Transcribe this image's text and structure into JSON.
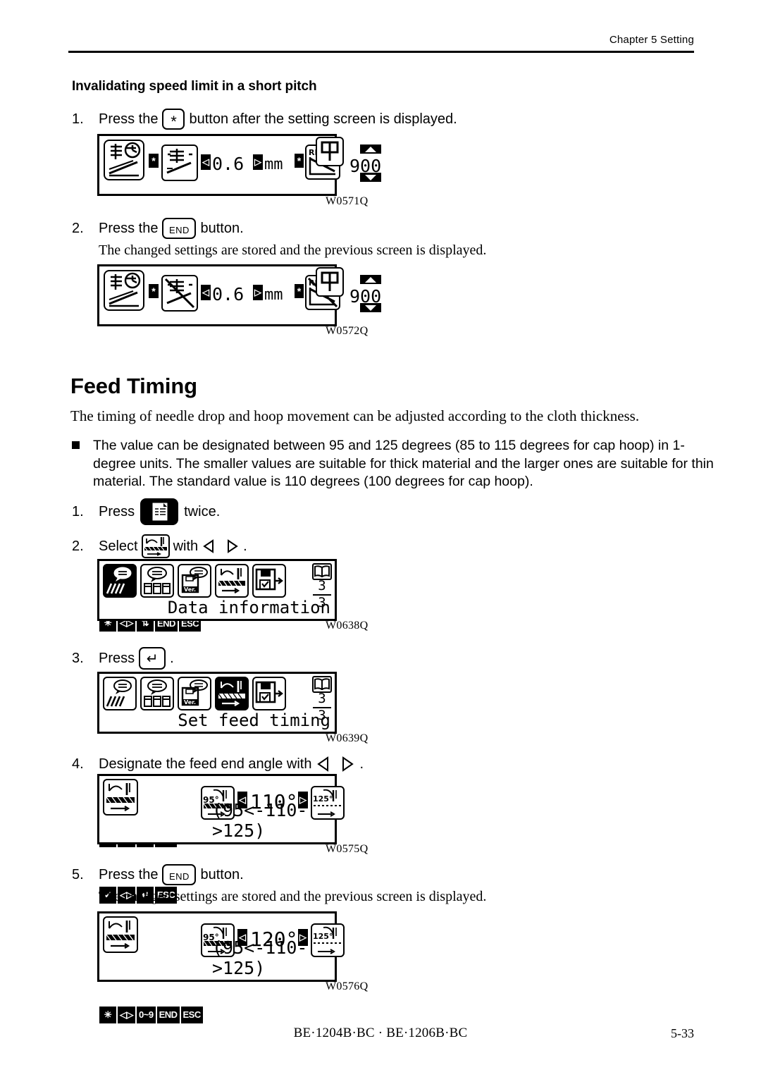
{
  "header": {
    "chapter": "Chapter 5   Setting"
  },
  "footer": {
    "models": "BE·1204B·BC · BE·1206B·BC",
    "page": "5-33"
  },
  "section_short_pitch": {
    "heading": "Invalidating speed limit in a short pitch",
    "steps": [
      {
        "num": "1.",
        "text_before": "Press the",
        "key": "*",
        "text_after": "button after the setting screen is displayed."
      },
      {
        "num": "2.",
        "text_before": "Press the",
        "key": "END",
        "text_after": "button.",
        "note": "The changed settings are stored and the previous screen is displayed."
      }
    ]
  },
  "section_feed_timing": {
    "heading": "Feed Timing",
    "intro": "The timing of needle drop and hoop movement can be adjusted according to the cloth thickness.",
    "bullet": "The value can be designated between 95 and 125 degrees (85 to 115 degrees for cap hoop) in 1-degree units.   The smaller values are suitable for thick material and the larger ones are suitable for thin material.   The standard value is 110 degrees (100 degrees for cap hoop).",
    "steps": [
      {
        "num": "1.",
        "text_before": "Press",
        "key_icon": "document-settings-icon",
        "text_after": "twice."
      },
      {
        "num": "2.",
        "text_before": "Select",
        "key_icon": "feed-timing-icon",
        "text_mid": "with",
        "text_after": "."
      },
      {
        "num": "3.",
        "text_before": "Press",
        "key": "↵",
        "text_after": "."
      },
      {
        "num": "4.",
        "text_before": "Designate the feed end angle with",
        "text_after": "."
      },
      {
        "num": "5.",
        "text_before": "Press the",
        "key": "END",
        "text_after": "button.",
        "note": "The changed settings are stored and the previous screen is displayed."
      }
    ]
  },
  "screens": [
    {
      "id": "W0571Q",
      "ref_label": "W0571Q",
      "name": "short-pitch-setting-screen",
      "icons": [
        "pitch-speed-graph-icon",
        "short-pitch-icon",
        "rpm-graph-icon",
        "needle-bar-icon"
      ],
      "value": "0.6",
      "unit": "mm",
      "rpm_value": "900",
      "marker_star_1": "*",
      "marker_star_2": "*",
      "arrow_left": "◁",
      "arrow_right": "▷",
      "softkeys": [
        "✳",
        "◁▷",
        "⇅",
        "END",
        "ESC"
      ]
    },
    {
      "id": "W0572Q",
      "ref_label": "W0572Q",
      "name": "short-pitch-disabled-screen",
      "icons": [
        "pitch-speed-graph-icon",
        "short-pitch-crossed-icon",
        "rpm-graph-crossed-icon",
        "needle-bar-icon"
      ],
      "value": "0.6",
      "unit": "mm",
      "rpm_value": "900",
      "marker_star_1": "*",
      "marker_star_2": "*",
      "softkeys": [
        "✳",
        "◁▷",
        "⇅",
        "END",
        "ESC"
      ]
    },
    {
      "id": "W0638Q",
      "ref_label": "W0638Q",
      "name": "data-information-menu-screen",
      "title": "Data information",
      "selected_index": 0,
      "icons": [
        "needle-data-icon",
        "thread-data-icon",
        "version-data-icon",
        "feed-timing-icon",
        "data-output-icon"
      ],
      "page_current": "3",
      "page_total": "3",
      "book_icon": "book-icon",
      "softkeys": [
        "✓",
        "◁▷",
        "↵",
        "ESC"
      ]
    },
    {
      "id": "W0639Q",
      "ref_label": "W0639Q",
      "name": "set-feed-timing-menu-screen",
      "title": "Set feed timing",
      "selected_index": 3,
      "icons": [
        "needle-data-icon",
        "thread-data-icon",
        "version-data-icon",
        "feed-timing-icon",
        "data-output-icon"
      ],
      "page_current": "3",
      "page_total": "3",
      "book_icon": "book-icon",
      "softkeys": [
        "✓",
        "◁▷",
        "↵",
        "ESC"
      ]
    },
    {
      "id": "W0575Q",
      "ref_label": "W0575Q",
      "name": "feed-end-angle-edit-screen",
      "title_icon": "feed-timing-icon",
      "min_label": "95°",
      "max_label": "125°",
      "value": "110°",
      "range_text": "(95<-110->125)",
      "softkeys": [
        "✳",
        "◁▷",
        "0~9",
        "END",
        "ESC"
      ]
    },
    {
      "id": "W0576Q",
      "ref_label": "W0576Q",
      "name": "feed-end-angle-stored-screen",
      "title_icon": "feed-timing-icon",
      "min_label": "95°",
      "max_label": "125°",
      "value": "120°",
      "range_text": "(95<-110->125)",
      "softkeys": [
        "✳",
        "◁▷",
        "0~9",
        "END",
        "ESC"
      ]
    }
  ]
}
